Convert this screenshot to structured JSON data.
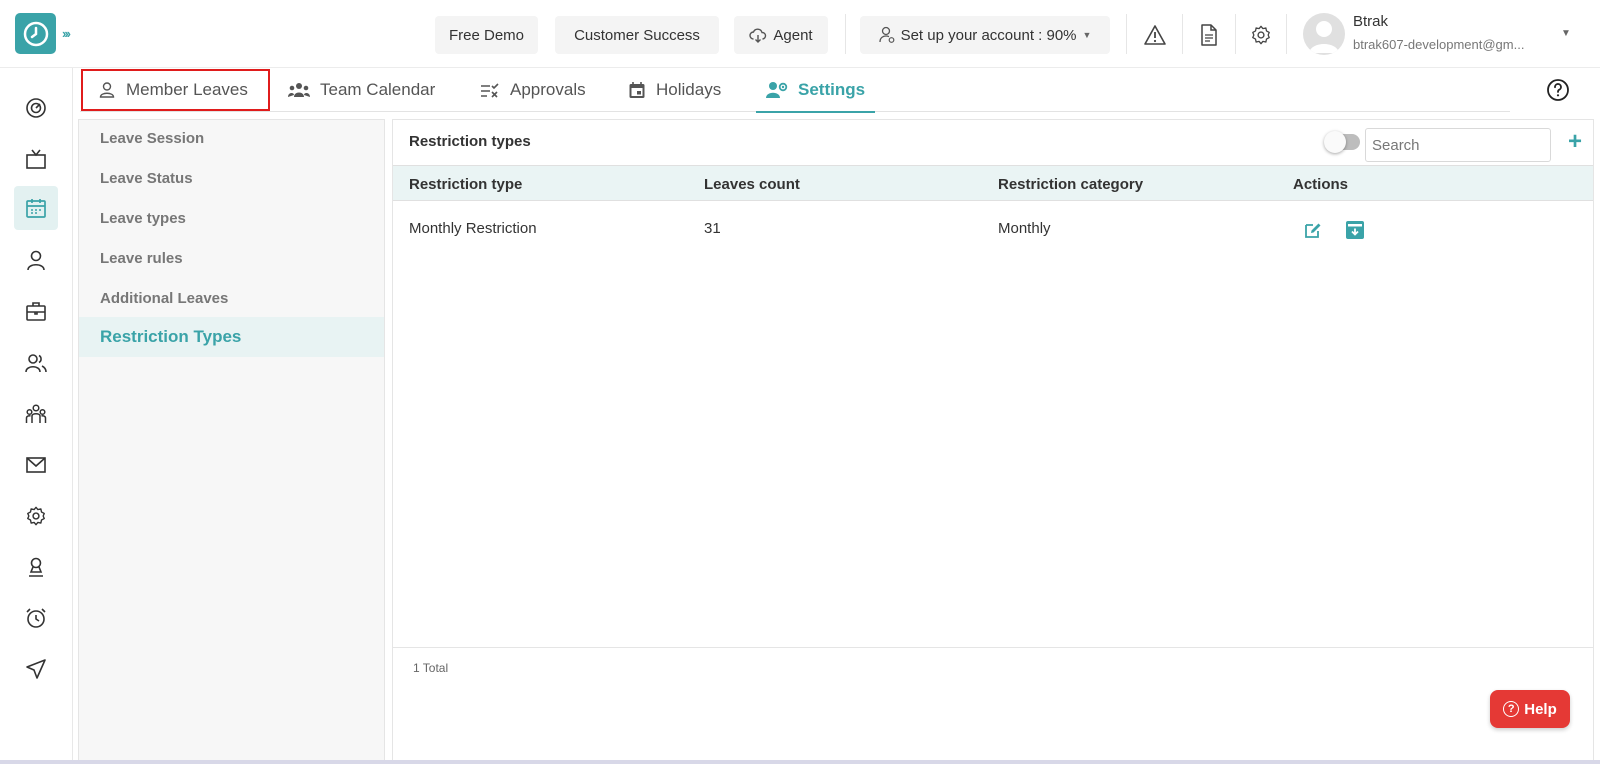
{
  "header": {
    "free_demo": "Free Demo",
    "customer_success": "Customer Success",
    "agent": "Agent",
    "setup": "Set up your account : 90%",
    "user_name": "Btrak",
    "user_email": "btrak607-development@gm..."
  },
  "tabs": [
    {
      "label": "Member Leaves",
      "icon": "person-icon"
    },
    {
      "label": "Team Calendar",
      "icon": "team-icon"
    },
    {
      "label": "Approvals",
      "icon": "approvals-icon"
    },
    {
      "label": "Holidays",
      "icon": "calendar-icon"
    },
    {
      "label": "Settings",
      "icon": "settings-people-icon",
      "active": true
    }
  ],
  "side_menu": [
    {
      "label": "Leave Session"
    },
    {
      "label": "Leave Status"
    },
    {
      "label": "Leave types"
    },
    {
      "label": "Leave rules"
    },
    {
      "label": "Additional Leaves"
    },
    {
      "label": "Restriction Types",
      "active": true
    }
  ],
  "panel": {
    "title": "Restriction types",
    "search_placeholder": "Search",
    "add_label": "+",
    "columns": [
      "Restriction type",
      "Leaves count",
      "Restriction category",
      "Actions"
    ],
    "rows": [
      {
        "type": "Monthly Restriction",
        "count": "31",
        "category": "Monthly"
      }
    ],
    "total": "1 Total"
  },
  "help_button": "Help",
  "colors": {
    "accent": "#3aa3a8",
    "highlight": "#e01c1c",
    "help": "#e53935"
  }
}
